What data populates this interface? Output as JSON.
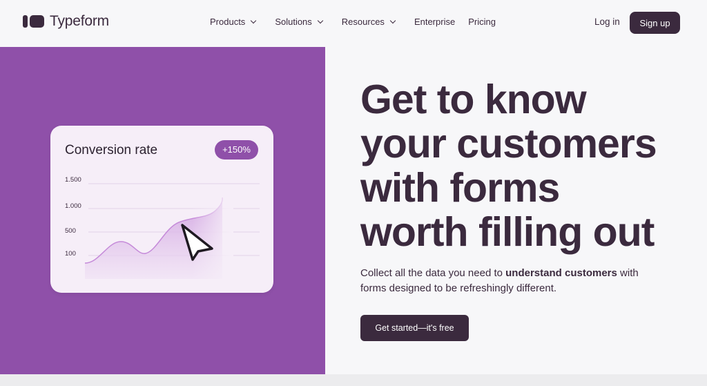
{
  "header": {
    "logo_text": "Typeform",
    "nav": [
      {
        "label": "Products",
        "has_dropdown": true
      },
      {
        "label": "Solutions",
        "has_dropdown": true
      },
      {
        "label": "Resources",
        "has_dropdown": true
      },
      {
        "label": "Enterprise",
        "has_dropdown": false
      },
      {
        "label": "Pricing",
        "has_dropdown": false
      }
    ],
    "login_label": "Log in",
    "signup_label": "Sign up"
  },
  "hero_card": {
    "title": "Conversion rate",
    "badge": "+150%",
    "y_ticks": [
      "1.500",
      "1.000",
      "500",
      "100"
    ],
    "cursor_icon": "pointer-arrow-icon"
  },
  "hero": {
    "headline_lines": [
      "Get to know",
      "your customers",
      "with forms",
      "worth filling out"
    ],
    "sub_pre": "Collect all the data you need to ",
    "sub_bold": "understand customers",
    "sub_post": " with forms designed to be refreshingly different.",
    "cta_label": "Get started—it's free"
  },
  "colors": {
    "brand_purple": "#8f50a9",
    "dark": "#3b2a3e",
    "background": "#f7f7f9",
    "card_bg": "#f6eef8"
  }
}
